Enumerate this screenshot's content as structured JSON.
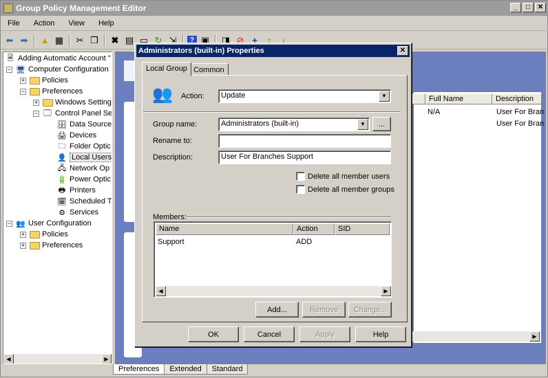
{
  "window": {
    "title": "Group Policy Management Editor"
  },
  "menu": [
    "File",
    "Action",
    "View",
    "Help"
  ],
  "tree": {
    "root": "Adding Automatic Account \"",
    "computer_config": "Computer Configuration",
    "policies": "Policies",
    "preferences": "Preferences",
    "windows_settings": "Windows Setting",
    "control_panel": "Control Panel Se",
    "data_sources": "Data Source",
    "devices": "Devices",
    "folder_options": "Folder Optic",
    "local_users": "Local Users",
    "network_options": "Network Op",
    "power_options": "Power Optic",
    "printers": "Printers",
    "scheduled_tasks": "Scheduled T",
    "services": "Services",
    "user_config": "User Configuration",
    "user_policies": "Policies",
    "user_preferences": "Preferences"
  },
  "right_pane": {
    "columns": [
      "Full Name",
      "Description"
    ],
    "rows": [
      {
        "full_name": "N/A",
        "description": "User For Bran"
      },
      {
        "full_name": "",
        "description": "User For Bran"
      }
    ]
  },
  "bottom_tabs": [
    "Preferences",
    "Extended",
    "Standard"
  ],
  "dialog": {
    "title": "Administrators (built-in) Properties",
    "tabs": [
      "Local Group",
      "Common"
    ],
    "action_label": "Action:",
    "action_value": "Update",
    "group_name_label": "Group name:",
    "group_name_value": "Administrators (built-in)",
    "browse_label": "...",
    "rename_label": "Rename to:",
    "rename_value": "",
    "description_label": "Description:",
    "description_value": "User For Branches Support",
    "delete_users_label": "Delete all member users",
    "delete_groups_label": "Delete all member groups",
    "members_label": "Members:",
    "members_columns": [
      "Name",
      "Action",
      "SID"
    ],
    "members": [
      {
        "name": "Support",
        "action": "ADD",
        "sid": ""
      }
    ],
    "add_button": "Add...",
    "remove_button": "Remove",
    "change_button": "Change...",
    "ok_button": "OK",
    "cancel_button": "Cancel",
    "apply_button": "Apply",
    "help_button": "Help"
  }
}
